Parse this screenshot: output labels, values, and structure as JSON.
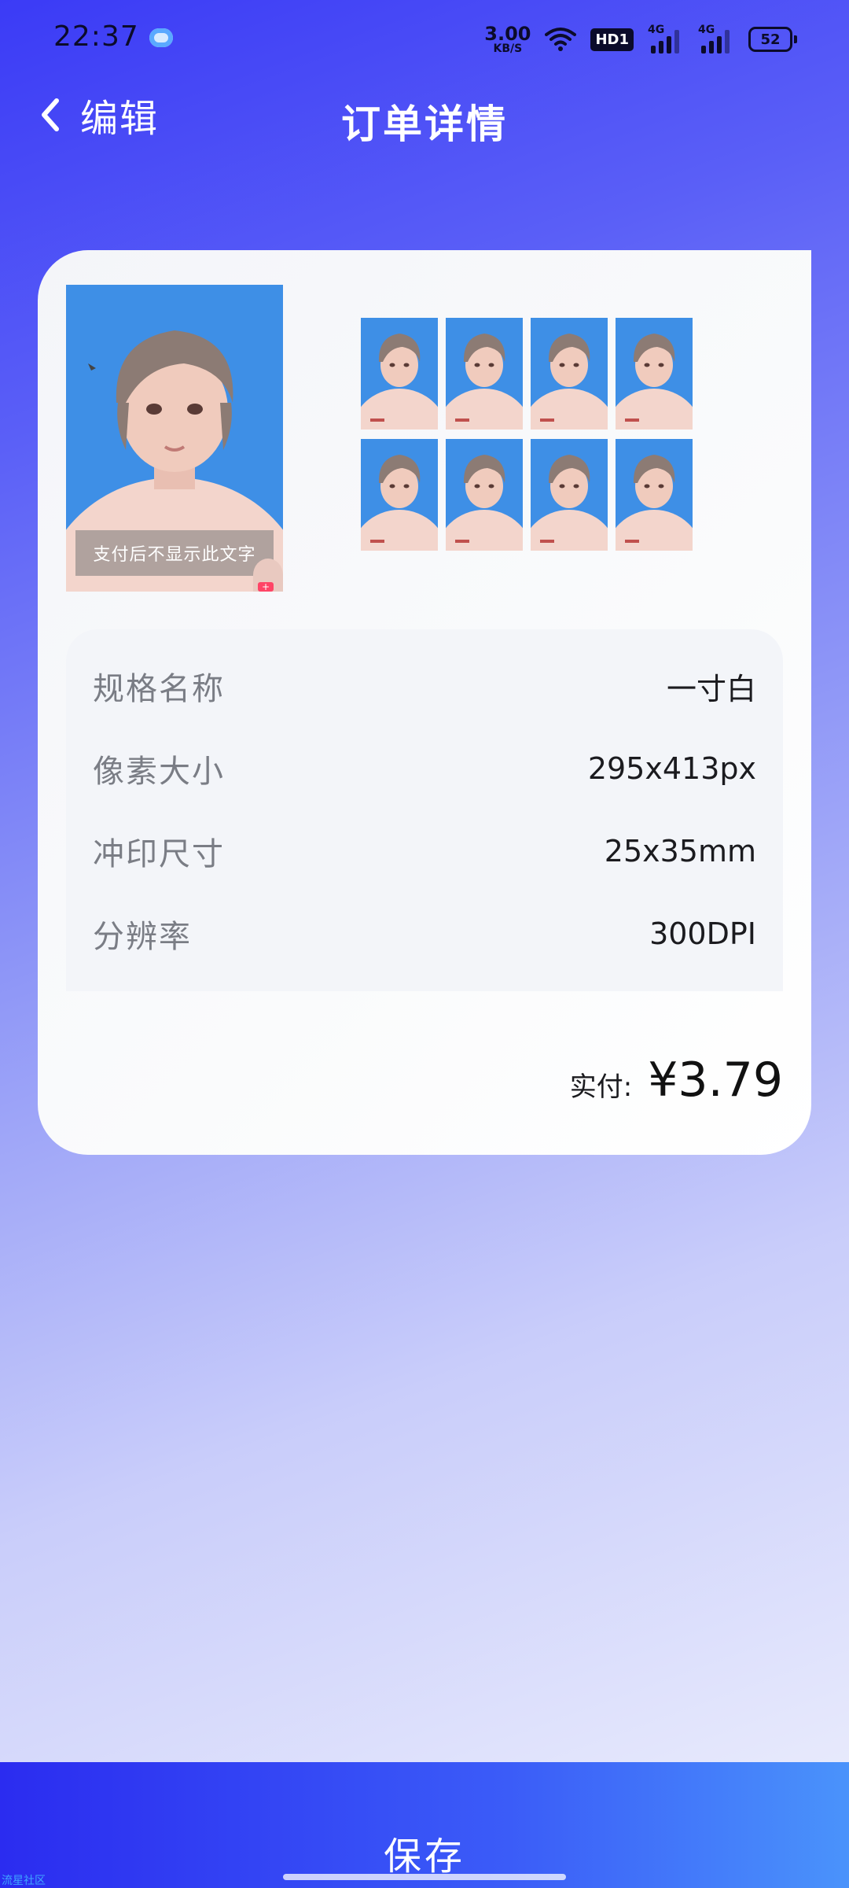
{
  "status_bar": {
    "time": "22:37",
    "net_speed_value": "3.00",
    "net_speed_unit": "KB/S",
    "hd_label": "HD1",
    "signal_1": "4G",
    "signal_2": "4G",
    "battery": "52"
  },
  "header": {
    "back_label": "编辑",
    "title": "订单详情"
  },
  "preview": {
    "watermark_text": "支付后不显示此文字",
    "background_color": "#3e8fe6"
  },
  "specs": [
    {
      "label": "规格名称",
      "value": "一寸白"
    },
    {
      "label": "像素大小",
      "value": "295x413px"
    },
    {
      "label": "冲印尺寸",
      "value": "25x35mm"
    },
    {
      "label": "分辨率",
      "value": "300DPI"
    }
  ],
  "payment": {
    "label": "实付:",
    "amount": "¥3.79"
  },
  "footer": {
    "save_label": "保存",
    "community_tag": "流星社区"
  }
}
